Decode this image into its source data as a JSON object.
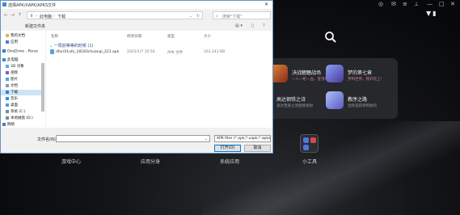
{
  "dialog": {
    "title": "选择APK/XAPK/APKS文件",
    "address": {
      "root": "此电脑",
      "current": "下载"
    },
    "search_placeholder": "搜索\"下载\"",
    "new_folder": "新建文件夹",
    "columns": [
      "名称",
      "修改日期",
      "类型",
      "大小"
    ],
    "group_header": "一周前等等的时候 (1)",
    "files": [
      {
        "name": "dfuri01ufo_18183chuanqi_221.apk",
        "date": "2025/1/7 10:50",
        "type": "APK 文件",
        "size": "161,141 KB"
      }
    ],
    "sidebar": [
      {
        "label": "我的文档",
        "color": "#e2b64a"
      },
      {
        "label": "应用",
        "color": "#4c7fd0"
      },
      {
        "label": "OneDrive - Perso",
        "color": "#2f7fd6"
      },
      {
        "label": "此电脑",
        "color": "#3a8bd8"
      },
      {
        "label": "3D 对象",
        "color": "#6aa5d8"
      },
      {
        "label": "视频",
        "color": "#7a5fc0"
      },
      {
        "label": "图片",
        "color": "#4aa6c8"
      },
      {
        "label": "文档",
        "color": "#8a9ab0"
      },
      {
        "label": "下载",
        "color": "#2f7fd6"
      },
      {
        "label": "音乐",
        "color": "#3a8bd8"
      },
      {
        "label": "桌面",
        "color": "#4c9be0"
      },
      {
        "label": "系统 (C:)",
        "color": "#7a8aa0"
      },
      {
        "label": "本地磁盘 (D:)",
        "color": "#7a8aa0"
      },
      {
        "label": "网络",
        "color": "#5a7ab0"
      }
    ],
    "filename_label": "文件名(N):",
    "filter": "APK files (*.apk;*.xapk;*.apks",
    "open_label": "打开(O)",
    "cancel_label": "取消"
  },
  "emulator": {
    "games": [
      {
        "name": "决战魍魉战场",
        "desc": "一人一枪一血，登顶！",
        "color": "#c95a2a"
      },
      {
        "name": "梦的第七章",
        "desc": "梦和世界，我开玩上！",
        "color": "#5a70d8"
      },
      {
        "name": "高达钢铁之诗",
        "desc": "高达塑质之诗直接发射",
        "color": "#2e3440"
      },
      {
        "name": "教序之路",
        "desc": "边际追踪师和他的",
        "color": "#6a7ad0"
      }
    ],
    "bottom_labels": [
      "游戏中心",
      "应用分身",
      "系统应用",
      "小工具"
    ]
  }
}
